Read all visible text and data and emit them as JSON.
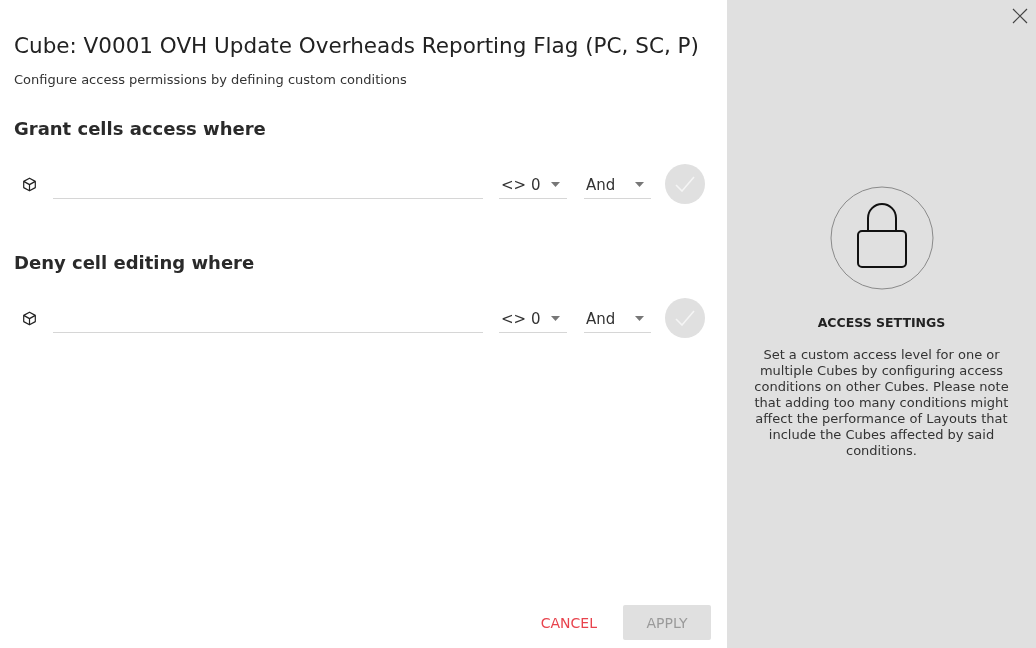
{
  "dialog": {
    "title": "Cube: V0001 OVH Update Overheads Reporting Flag (PC, SC, P)",
    "subtitle": "Configure access permissions by defining custom conditions"
  },
  "sections": [
    {
      "heading": "Grant cells access where",
      "conditions": [
        {
          "operator": "<> 0",
          "logic": "And",
          "confirm": {
            "disabled": true
          }
        }
      ]
    },
    {
      "heading": "Deny cell editing where",
      "conditions": [
        {
          "operator": "<> 0",
          "logic": "And",
          "confirm": {
            "disabled": true
          }
        }
      ]
    }
  ],
  "footer": {
    "buttons": [
      {
        "label": "CANCEL",
        "kind": "text",
        "disabled": false
      },
      {
        "label": "APPLY",
        "kind": "filled",
        "disabled": true
      }
    ]
  },
  "info_panel": {
    "heading": "ACCESS SETTINGS",
    "text": "Set a custom access level for one or multiple Cubes by configuring access conditions on other Cubes. Please note that adding too many conditions might affect the performance of Layouts that include the Cubes affected by said conditions."
  }
}
